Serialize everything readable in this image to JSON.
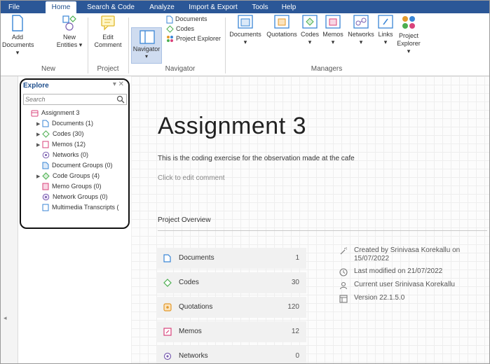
{
  "ribbon": {
    "tabs": [
      {
        "label": "File"
      },
      {
        "label": "Home"
      },
      {
        "label": "Search & Code"
      },
      {
        "label": "Analyze"
      },
      {
        "label": "Import & Export"
      },
      {
        "label": "Tools"
      },
      {
        "label": "Help"
      }
    ],
    "active_tab": "Home",
    "groups": {
      "new": "New",
      "project": "Project",
      "navigator": "Navigator",
      "managers": "Managers"
    },
    "buttons": {
      "add_documents": [
        "Add",
        "Documents ▾"
      ],
      "new_entities": [
        "New",
        "Entities ▾"
      ],
      "edit_comment": [
        "Edit",
        "Comment"
      ],
      "navigator": "Navigator",
      "navigator_caret": "▾",
      "nav_documents": "Documents",
      "nav_codes": "Codes",
      "nav_project_explorer": "Project Explorer",
      "mgr_documents": "Documents",
      "mgr_quotations": "Quotations",
      "mgr_codes": "Codes",
      "mgr_memos": "Memos",
      "mgr_networks": "Networks",
      "mgr_links": "Links",
      "project_explorer": [
        "Project",
        "Explorer ▾"
      ],
      "caret": "▾"
    }
  },
  "explore": {
    "title": "Explore",
    "controls": "▾ ✕",
    "search_placeholder": "Search",
    "tree": [
      {
        "label": "Assignment 3",
        "icon": "project-icon",
        "arrow": ""
      },
      {
        "label": "Documents (1)",
        "icon": "documents-icon",
        "arrow": "▶"
      },
      {
        "label": "Codes (30)",
        "icon": "codes-icon",
        "arrow": "▶"
      },
      {
        "label": "Memos (12)",
        "icon": "memos-icon",
        "arrow": "▶"
      },
      {
        "label": "Networks (0)",
        "icon": "networks-icon",
        "arrow": ""
      },
      {
        "label": "Document Groups (0)",
        "icon": "document-groups-icon",
        "arrow": ""
      },
      {
        "label": "Code Groups (4)",
        "icon": "code-groups-icon",
        "arrow": "▶"
      },
      {
        "label": "Memo Groups (0)",
        "icon": "memo-groups-icon",
        "arrow": ""
      },
      {
        "label": "Network Groups (0)",
        "icon": "network-groups-icon",
        "arrow": ""
      },
      {
        "label": "Multimedia Transcripts (",
        "icon": "transcripts-icon",
        "arrow": ""
      }
    ]
  },
  "main": {
    "title": "Assignment 3",
    "description": "This is the coding exercise for the observation made at the cafe",
    "comment_hint": "Click to edit comment",
    "overview_label": "Project Overview",
    "stats": [
      {
        "label": "Documents",
        "value": "1",
        "icon": "documents-icon"
      },
      {
        "label": "Codes",
        "value": "30",
        "icon": "codes-icon"
      },
      {
        "label": "Quotations",
        "value": "120",
        "icon": "quotations-icon"
      },
      {
        "label": "Memos",
        "value": "12",
        "icon": "memos-icon"
      },
      {
        "label": "Networks",
        "value": "0",
        "icon": "networks-icon"
      }
    ],
    "info": [
      {
        "text": "Created by Srinivasa Korekallu on 15/07/2022",
        "icon": "created-icon"
      },
      {
        "text": "Last modified on 21/07/2022",
        "icon": "clock-icon"
      },
      {
        "text": "Current user Srinivasa Korekallu",
        "icon": "user-icon"
      },
      {
        "text": "Version 22.1.5.0",
        "icon": "version-icon"
      }
    ]
  },
  "left_strip": {
    "grip": "◂"
  },
  "colors": {
    "ribbon_blue": "#2b5797",
    "documents": "#3a86d6",
    "codes": "#4caf50",
    "memos": "#d9437b",
    "quotations": "#e39a2c",
    "networks": "#7a5fb0"
  }
}
